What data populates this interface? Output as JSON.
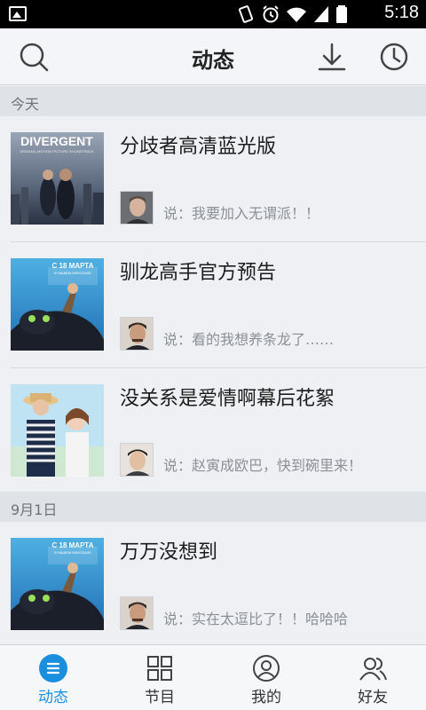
{
  "status_bar": {
    "time": "5:18"
  },
  "header": {
    "title": "动态"
  },
  "sections": [
    {
      "label": "今天"
    },
    {
      "label": "9月1日"
    }
  ],
  "feed": [
    {
      "title": "分歧者高清蓝光版",
      "comment": "说：我要加入无谓派！！",
      "poster_text": "DIVERGENT",
      "poster_subtext": "ORIGINAL MOTION PICTURE SOUNDTRACK"
    },
    {
      "title": "驯龙高手官方预告",
      "comment": "说：看的我想养条龙了……",
      "poster_text": "С 18 МАРТА",
      "poster_subtext": "В НАШЕМ КИНОЗАЛЕ"
    },
    {
      "title": "没关系是爱情啊幕后花絮",
      "comment": "说：赵寅成欧巴，快到碗里来！"
    },
    {
      "title": "万万没想到",
      "comment": "说：实在太逗比了！！哈哈哈",
      "poster_text": "С 18 МАРТА",
      "poster_subtext": "В НАШЕМ КИНОЗАЛЕ"
    }
  ],
  "tabs": [
    {
      "label": "动态",
      "icon": "feed-icon",
      "active": true
    },
    {
      "label": "节目",
      "icon": "grid-icon",
      "active": false
    },
    {
      "label": "我的",
      "icon": "profile-icon",
      "active": false
    },
    {
      "label": "好友",
      "icon": "friends-icon",
      "active": false
    }
  ],
  "colors": {
    "accent": "#1a8fe0",
    "background": "#eef0f4",
    "section_bg": "#dfe2e7"
  }
}
